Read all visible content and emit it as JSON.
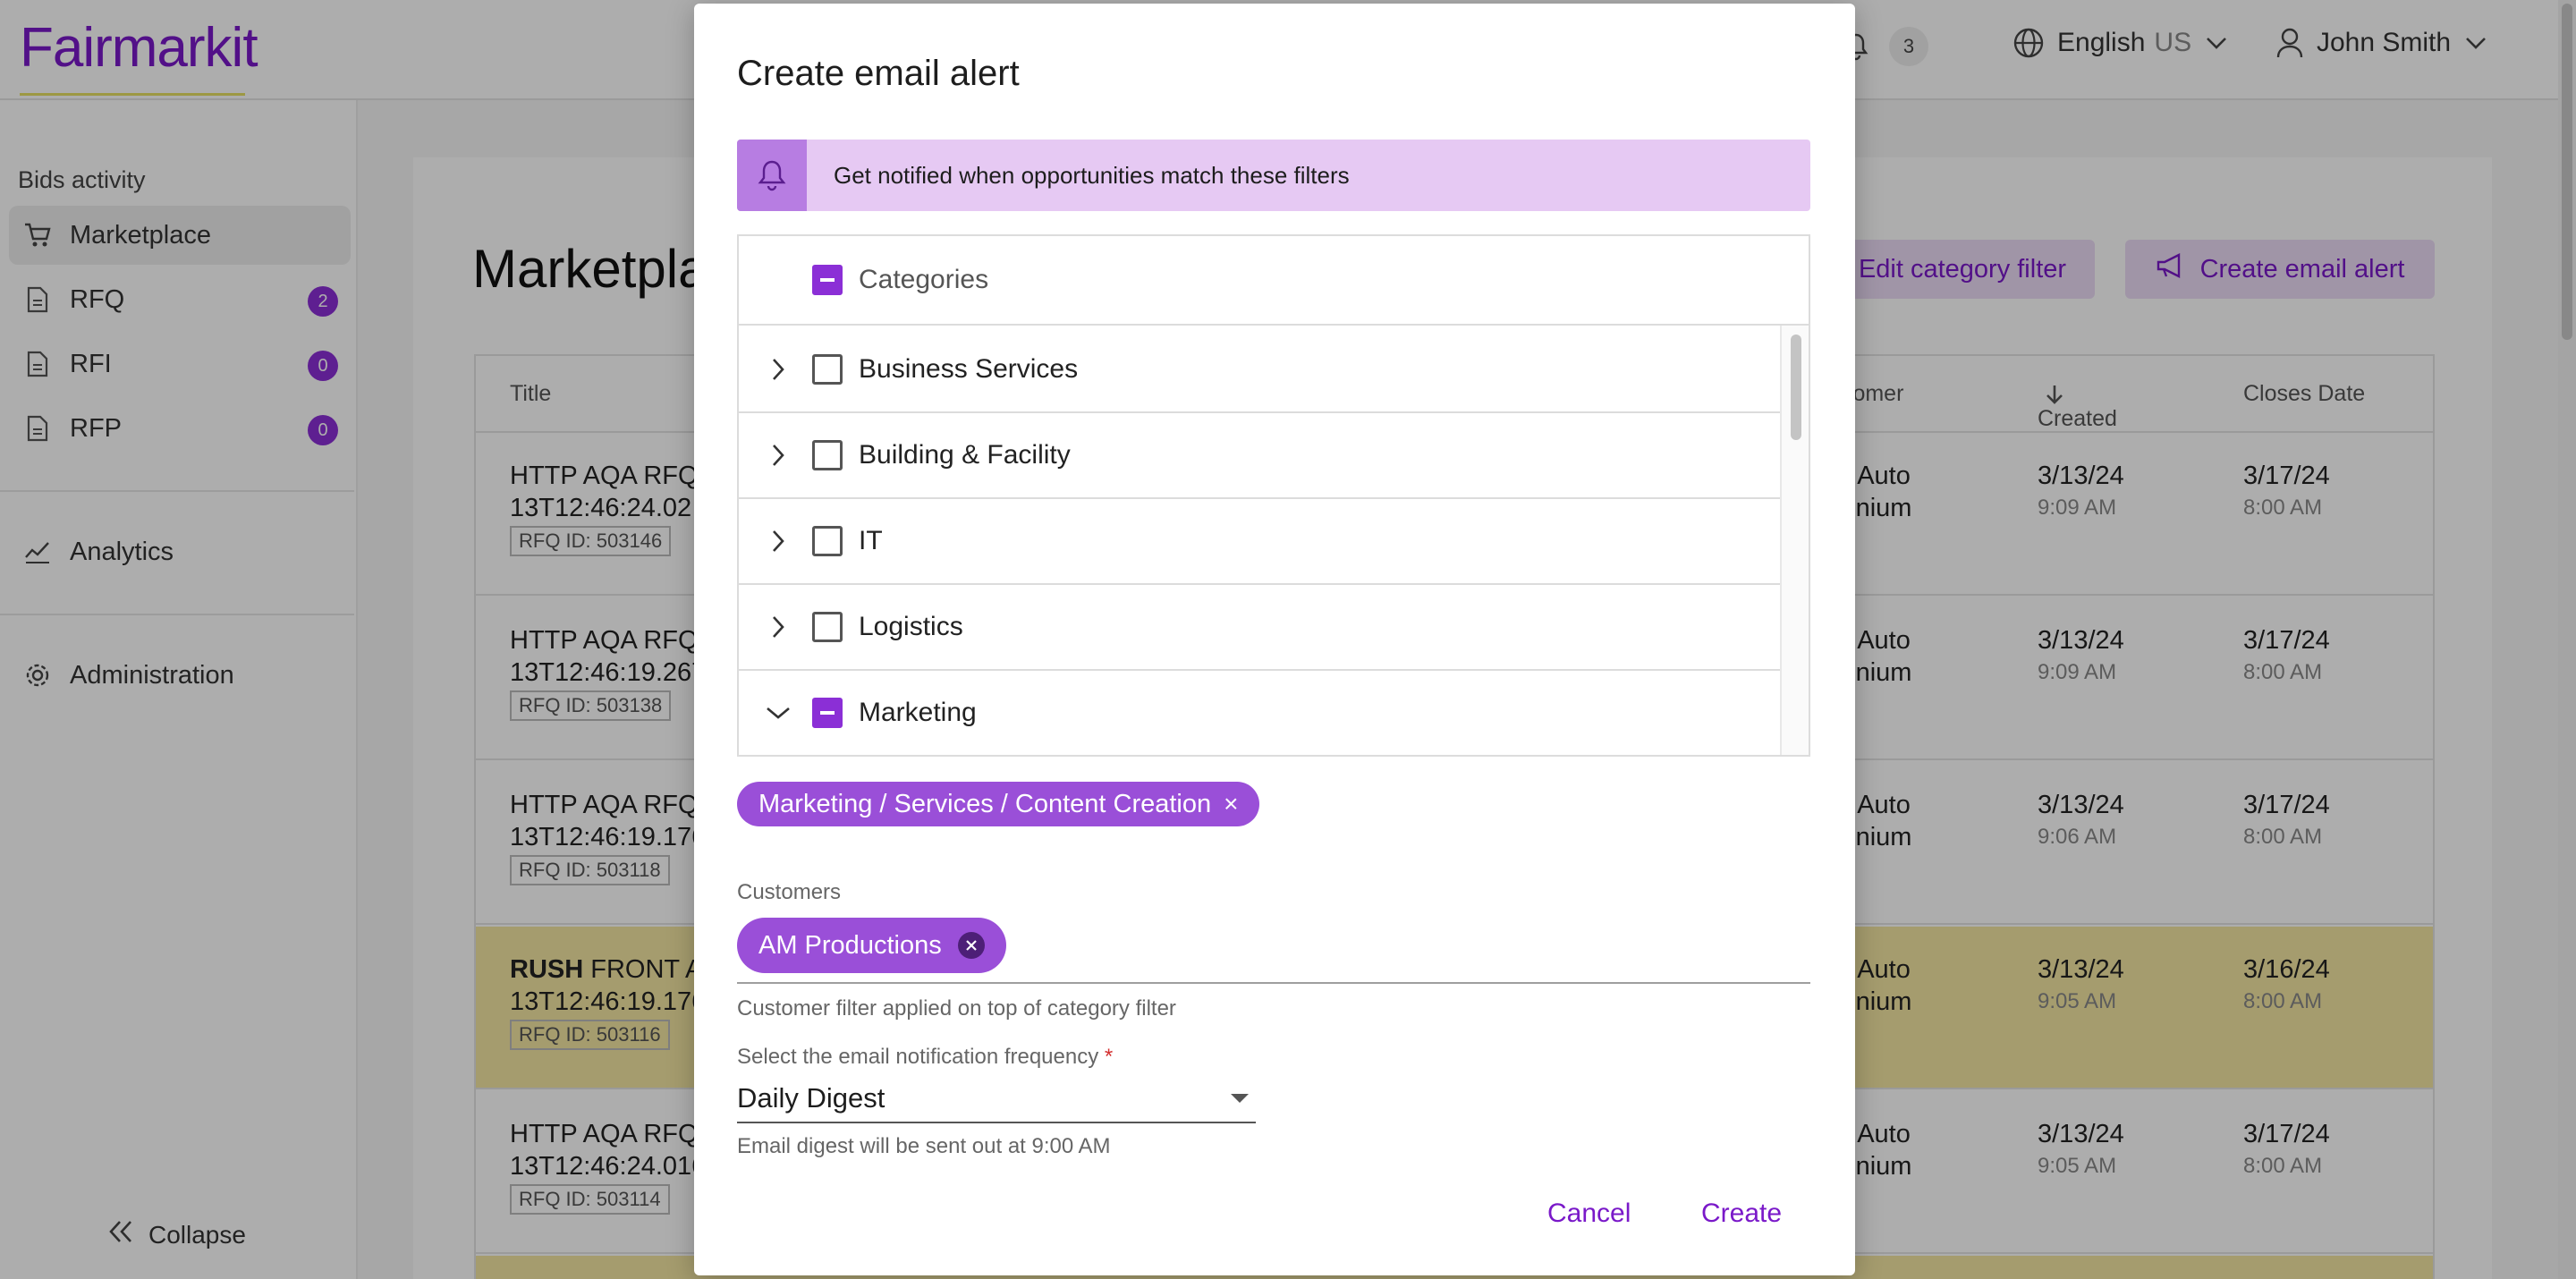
{
  "header": {
    "logo": "Fairmarkit",
    "notifications_count": "3",
    "language": "English",
    "language_region": "US",
    "user_name": "John Smith"
  },
  "sidebar": {
    "section_label": "Bids activity",
    "items": [
      {
        "label": "Marketplace",
        "icon": "cart-icon",
        "badge": ""
      },
      {
        "label": "RFQ",
        "icon": "document-icon",
        "badge": "2"
      },
      {
        "label": "RFI",
        "icon": "document-icon",
        "badge": "0"
      },
      {
        "label": "RFP",
        "icon": "document-icon",
        "badge": "0"
      }
    ],
    "analytics": "Analytics",
    "administration": "Administration",
    "collapse": "Collapse"
  },
  "main": {
    "page_title": "Marketpla",
    "edit_category_filter": "Edit category filter",
    "create_email_alert": "Create email alert",
    "columns": {
      "title": "Title",
      "customer": "stomer",
      "created": "Created Date",
      "closes": "Closes Date"
    },
    "rows": [
      {
        "rush": "",
        "title1": "HTTP AQA RFQ",
        "title2": "13T12:46:24.02",
        "rfq_id": "RFQ ID: 503146",
        "cust1": "A Auto",
        "cust2": "lenium",
        "created": "3/13/24",
        "created_time": "9:09 AM",
        "closes": "3/17/24",
        "closes_time": "8:00 AM"
      },
      {
        "rush": "",
        "title1": "HTTP AQA RFQ",
        "title2": "13T12:46:19.267",
        "rfq_id": "RFQ ID: 503138",
        "cust1": "A Auto",
        "cust2": "lenium",
        "created": "3/13/24",
        "created_time": "9:09 AM",
        "closes": "3/17/24",
        "closes_time": "8:00 AM"
      },
      {
        "rush": "",
        "title1": "HTTP AQA RFQ",
        "title2": "13T12:46:19.176",
        "rfq_id": "RFQ ID: 503118",
        "cust1": "A Auto",
        "cust2": "lenium",
        "created": "3/13/24",
        "created_time": "9:06 AM",
        "closes": "3/17/24",
        "closes_time": "8:00 AM"
      },
      {
        "rush": "RUSH",
        "title1": " FRONT A",
        "title2": "13T12:46:19.176",
        "rfq_id": "RFQ ID: 503116",
        "cust1": "A Auto",
        "cust2": "lenium",
        "created": "3/13/24",
        "created_time": "9:05 AM",
        "closes": "3/16/24",
        "closes_time": "8:00 AM"
      },
      {
        "rush": "",
        "title1": "HTTP AQA RFQ",
        "title2": "13T12:46:24.016",
        "rfq_id": "RFQ ID: 503114",
        "cust1": "A Auto",
        "cust2": "lenium",
        "created": "3/13/24",
        "created_time": "9:05 AM",
        "closes": "3/17/24",
        "closes_time": "8:00 AM"
      }
    ]
  },
  "modal": {
    "title": "Create email alert",
    "notice": "Get notified when opportunities match these filters",
    "categories_header": "Categories",
    "categories": [
      {
        "label": "Business Services",
        "state": "unchecked",
        "expanded": false
      },
      {
        "label": "Building & Facility",
        "state": "unchecked",
        "expanded": false
      },
      {
        "label": "IT",
        "state": "unchecked",
        "expanded": false
      },
      {
        "label": "Logistics",
        "state": "unchecked",
        "expanded": false
      },
      {
        "label": "Marketing",
        "state": "indeterminate",
        "expanded": true
      }
    ],
    "selected_category_chip": "Marketing / Services / Content Creation",
    "customers_label": "Customers",
    "customer_chip": "AM Productions",
    "customer_helper": "Customer filter applied on top of category filter",
    "frequency_label": "Select the email notification frequency",
    "frequency_required": "*",
    "frequency_value": "Daily Digest",
    "frequency_helper": "Email digest will be sent out at 9:00 AM",
    "cancel": "Cancel",
    "create": "Create"
  },
  "colors": {
    "brand": "#7a19c9",
    "accent_chip": "#9a4fd8",
    "notice_bg": "#e6c9f3",
    "rush_row": "#f3e6a3"
  }
}
